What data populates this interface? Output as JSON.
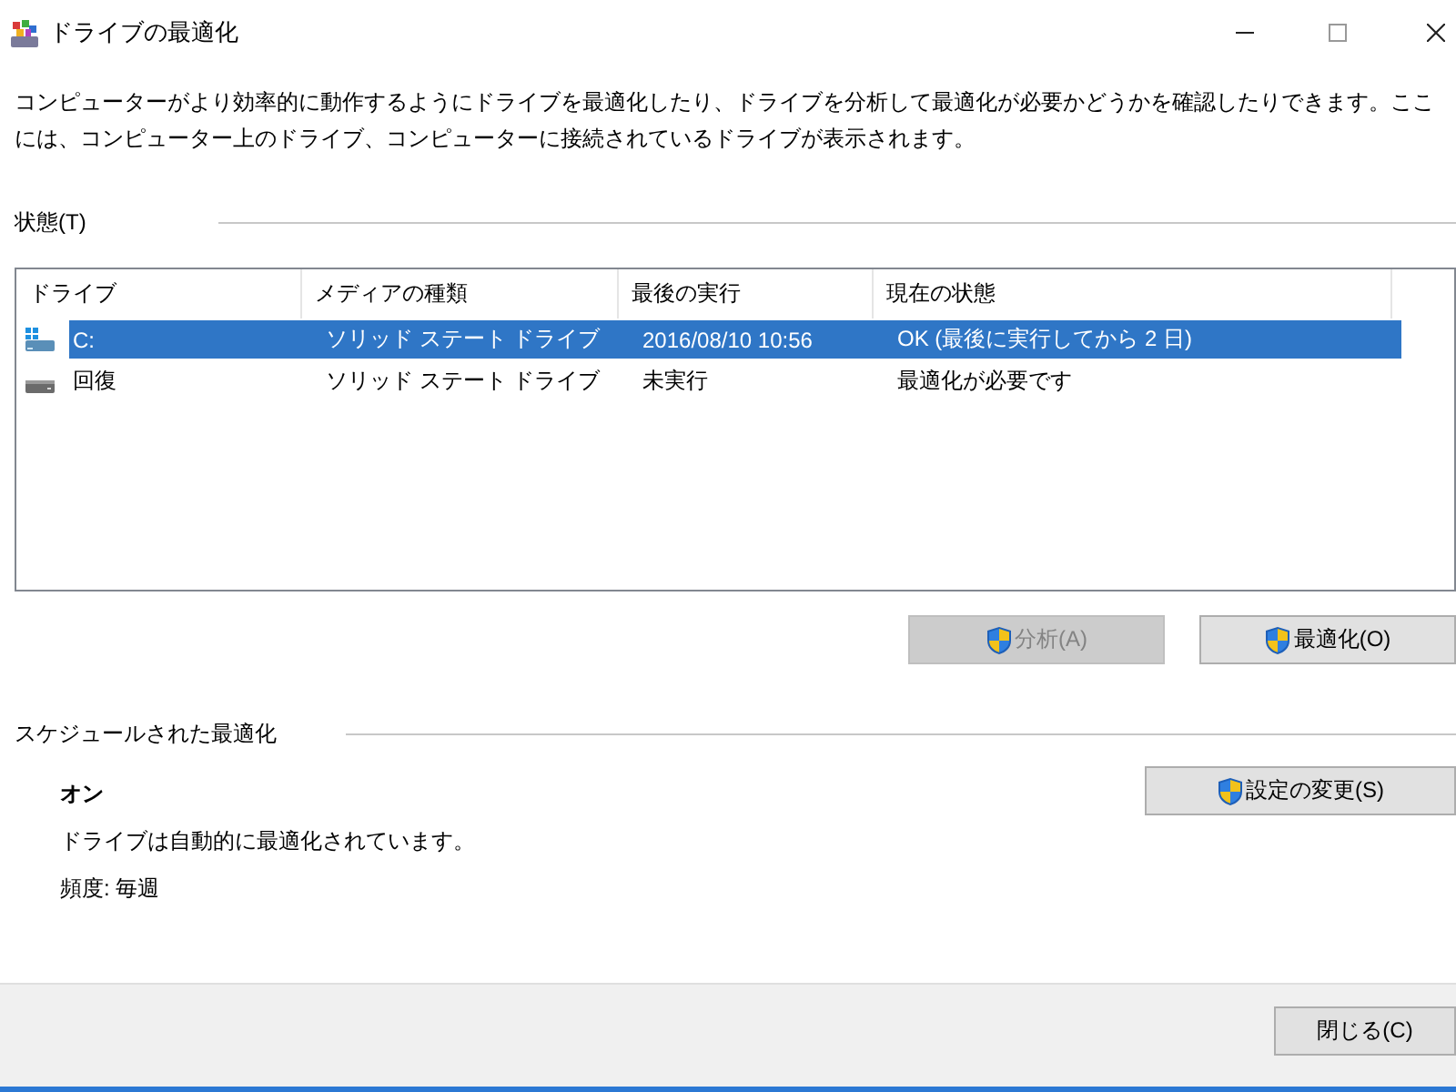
{
  "window": {
    "title": "ドライブの最適化"
  },
  "description": "コンピューターがより効率的に動作するようにドライブを最適化したり、ドライブを分析して最適化が必要かどうかを確認したりできます。ここには、コンピューター上のドライブ、コンピューターに接続されているドライブが表示されます。",
  "status": {
    "title": "状態(T)",
    "columns": [
      "ドライブ",
      "メディアの種類",
      "最後の実行",
      "現在の状態"
    ],
    "rows": [
      {
        "kind": "system",
        "drive": "C:",
        "media": "ソリッド ステート ドライブ",
        "last_run": "2016/08/10 10:56",
        "status": "OK (最後に実行してから 2 日)",
        "selected": true
      },
      {
        "kind": "plain",
        "drive": "回復",
        "media": "ソリッド ステート ドライブ",
        "last_run": "未実行",
        "status": "最適化が必要です",
        "selected": false
      }
    ],
    "buttons": [
      {
        "label": "分析(A)",
        "disabled": true
      },
      {
        "label": "最適化(O)",
        "disabled": false
      }
    ]
  },
  "schedule": {
    "title": "スケジュールされた最適化",
    "state": "オン",
    "description": "ドライブは自動的に最適化されています。",
    "frequency": "頻度: 毎週",
    "button": {
      "label": "設定の変更(S)"
    }
  },
  "footer": {
    "close_button": "閉じる(C)"
  }
}
